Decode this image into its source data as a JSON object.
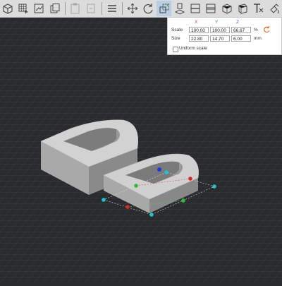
{
  "toolbar": {
    "items": [
      {
        "name": "view-cube-icon"
      },
      {
        "name": "select-all-icon"
      },
      {
        "name": "arrange-icon"
      },
      {
        "name": "copy-icon"
      },
      {
        "name": "paste-icon",
        "disabled": true
      },
      {
        "name": "delete-icon",
        "disabled": true
      },
      {
        "name": "menu-icon"
      },
      {
        "name": "move-icon"
      },
      {
        "name": "rotate-icon"
      },
      {
        "name": "scale-icon",
        "active": true
      },
      {
        "name": "place-on-face-icon"
      },
      {
        "name": "cut-icon"
      },
      {
        "name": "split-icon"
      },
      {
        "name": "split-parts-icon"
      },
      {
        "name": "layers-icon"
      },
      {
        "name": "text-icon"
      },
      {
        "name": "paint-icon"
      }
    ]
  },
  "scale_panel": {
    "headers": {
      "x": "X",
      "y": "Y",
      "z": "Z"
    },
    "colors": {
      "x": "#e0403a",
      "y": "#3aa040",
      "z": "#3a5ee0",
      "reset": "#e06a20"
    },
    "scale": {
      "label": "Scale",
      "x": "100.00",
      "y": "100.00",
      "z": "66.67",
      "unit": "%"
    },
    "size": {
      "label": "Size",
      "x": "22.80",
      "y": "14.70",
      "z": "6.00",
      "unit": "mm"
    },
    "uniform": {
      "label": "Uniform scale",
      "checked": false
    }
  }
}
